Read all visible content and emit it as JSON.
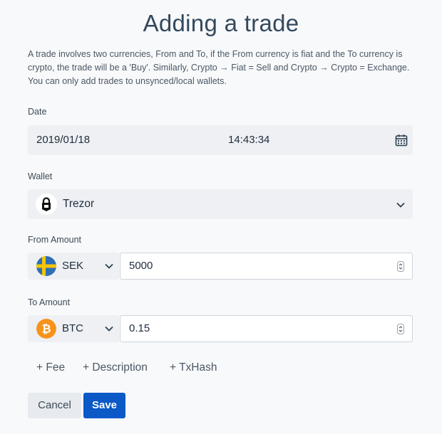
{
  "title": "Adding a trade",
  "description": "A trade involves two currencies, From and To, if the From currency is fiat and the To currency is crypto, the trade will be a 'Buy'. Similarly, Crypto → Fiat = Sell and Crypto → Crypto = Exchange. You can only add trades to unsynced/local wallets.",
  "date": {
    "label": "Date",
    "date_value": "2019/01/18",
    "time_value": "14:43:34",
    "icon": "calendar-icon"
  },
  "wallet": {
    "label": "Wallet",
    "selected": "Trezor",
    "icon": "trezor-icon"
  },
  "from_amount": {
    "label": "From Amount",
    "currency": "SEK",
    "currency_icon": "sweden-flag-icon",
    "value": "5000"
  },
  "to_amount": {
    "label": "To Amount",
    "currency": "BTC",
    "currency_icon": "bitcoin-icon",
    "value": "0.15"
  },
  "extras": {
    "fee": "+ Fee",
    "description": "+ Description",
    "txhash": "+ TxHash"
  },
  "buttons": {
    "cancel": "Cancel",
    "save": "Save"
  },
  "colors": {
    "primary": "#0b58c7",
    "field_bg": "#eef0f3",
    "bitcoin": "#f7931a",
    "sweden_blue": "#2f6fb5",
    "sweden_yellow": "#f7c600"
  }
}
